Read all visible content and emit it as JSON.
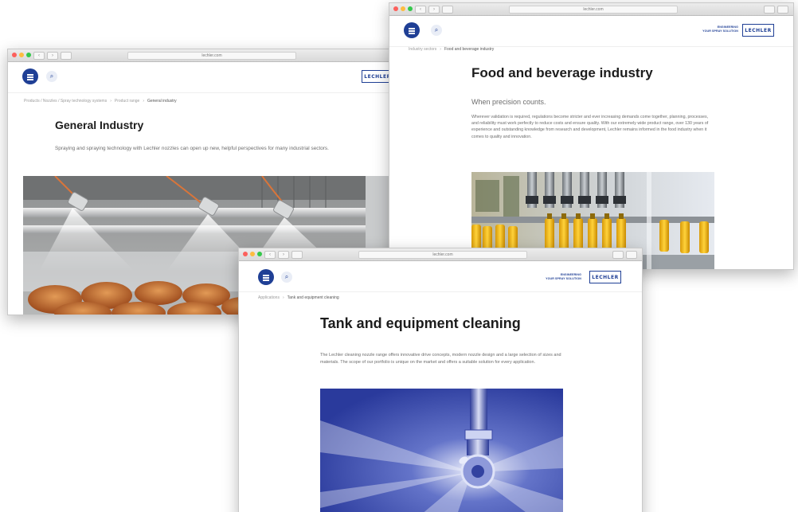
{
  "windows": {
    "general": {
      "url": "lechler.com",
      "breadcrumb": [
        "Products / Nozzles / Spray technology systems",
        "Product range",
        "General industry"
      ],
      "title": "General Industry",
      "intro": "Spraying and spraying technology with Lechler nozzles can open up new, helpful perspectives for many industrial sectors."
    },
    "food": {
      "url": "lechler.com",
      "tagline": [
        "ENGINEERING",
        "YOUR SPRAY SOLUTION"
      ],
      "breadcrumb": [
        "Industry sectors",
        "Food and beverage industry"
      ],
      "title": "Food and beverage industry",
      "subtitle": "When precision counts.",
      "intro": "Wherever validation is required, regulations become stricter and ever increasing demands come together, planning, processes, and reliability must work perfectly to reduce costs and ensure quality. With our extremely wide product range, over 130 years of experience and outstanding knowledge from research and development, Lechler remains informed in the food industry when it comes to quality and innovation."
    },
    "tank": {
      "url": "lechler.com",
      "tagline": [
        "ENGINEERING",
        "YOUR SPRAY SOLUTION"
      ],
      "breadcrumb": [
        "Applications",
        "Tank and equipment cleaning"
      ],
      "title": "Tank and equipment cleaning",
      "intro": "The Lechler cleaning nozzle range offers innovative drive concepts, modern nozzle design and a large selection of sizes and materials. The scope of our portfolio is unique on the market and offers a suitable solution for every application."
    }
  },
  "brand": {
    "logo_text": "LECHLER",
    "accent": "#1f3f95"
  },
  "icons": {
    "menu": "hamburger-icon",
    "search": "search-icon"
  }
}
